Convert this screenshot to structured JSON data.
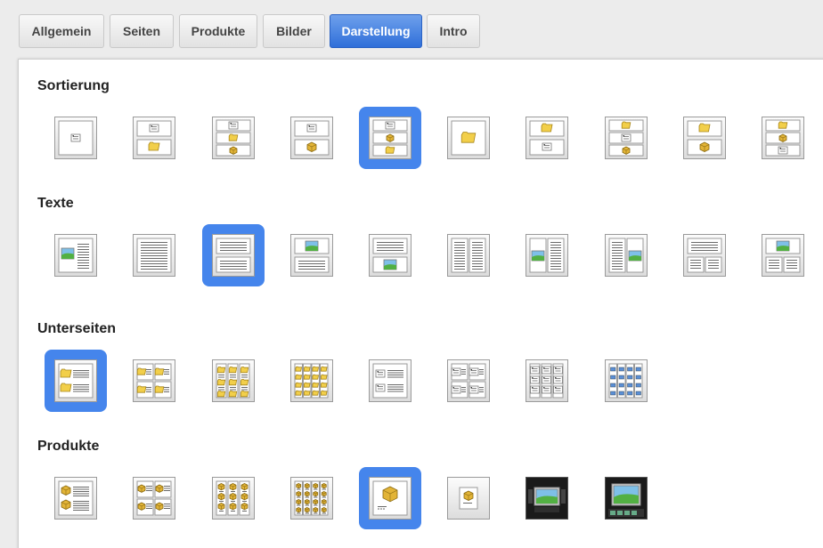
{
  "tabs": [
    {
      "id": "allgemein",
      "label": "Allgemein",
      "active": false
    },
    {
      "id": "seiten",
      "label": "Seiten",
      "active": false
    },
    {
      "id": "produkte",
      "label": "Produkte",
      "active": false
    },
    {
      "id": "bilder",
      "label": "Bilder",
      "active": false
    },
    {
      "id": "darstellung",
      "label": "Darstellung",
      "active": true
    },
    {
      "id": "intro",
      "label": "Intro",
      "active": false
    }
  ],
  "colors": {
    "accent": "#4585ec",
    "folder": "#f2cf4a",
    "cube": "#e2b437",
    "image_sky": "#7ec0e8",
    "image_grass": "#52b043"
  },
  "sections": [
    {
      "id": "sortierung",
      "title": "Sortierung",
      "selected_index": 4,
      "options": [
        {
          "icon": "single-text-layout-icon"
        },
        {
          "icon": "text-over-folder-layout-icon"
        },
        {
          "icon": "text-folder-product-layout-icon"
        },
        {
          "icon": "text-over-product-layout-icon"
        },
        {
          "icon": "text-product-folder-layout-icon"
        },
        {
          "icon": "single-folder-layout-icon"
        },
        {
          "icon": "folder-over-text-layout-icon"
        },
        {
          "icon": "folder-text-product-layout-icon"
        },
        {
          "icon": "folder-over-product-layout-icon"
        },
        {
          "icon": "folder-product-text-layout-icon"
        }
      ]
    },
    {
      "id": "texte",
      "title": "Texte",
      "selected_index": 2,
      "options": [
        {
          "icon": "image-left-text-layout-icon"
        },
        {
          "icon": "full-text-layout-icon"
        },
        {
          "icon": "text-two-blocks-layout-icon"
        },
        {
          "icon": "image-top-text-layout-icon"
        },
        {
          "icon": "image-bottom-text-layout-icon"
        },
        {
          "icon": "two-columns-text-layout-icon"
        },
        {
          "icon": "image-in-left-column-layout-icon"
        },
        {
          "icon": "image-in-right-column-layout-icon"
        },
        {
          "icon": "header-two-columns-layout-icon"
        },
        {
          "icon": "image-header-two-columns-layout-icon"
        }
      ]
    },
    {
      "id": "unterseiten",
      "title": "Unterseiten",
      "selected_index": 0,
      "options": [
        {
          "icon": "folder-list-1col-icon"
        },
        {
          "icon": "folder-grid-2col-icon"
        },
        {
          "icon": "folder-grid-3col-icon"
        },
        {
          "icon": "folder-grid-4col-icon"
        },
        {
          "icon": "page-list-1col-icon"
        },
        {
          "icon": "page-grid-2col-icon"
        },
        {
          "icon": "page-grid-3col-icon"
        },
        {
          "icon": "page-grid-4col-icon"
        }
      ]
    },
    {
      "id": "produkte",
      "title": "Produkte",
      "selected_index": 4,
      "options": [
        {
          "icon": "product-list-1col-icon"
        },
        {
          "icon": "product-grid-2col-icon"
        },
        {
          "icon": "product-grid-3col-icon"
        },
        {
          "icon": "product-grid-4col-icon"
        },
        {
          "icon": "product-large-single-icon"
        },
        {
          "icon": "product-small-single-icon"
        },
        {
          "icon": "dark-slideshow-icon"
        },
        {
          "icon": "dark-gallery-icon"
        }
      ]
    }
  ]
}
